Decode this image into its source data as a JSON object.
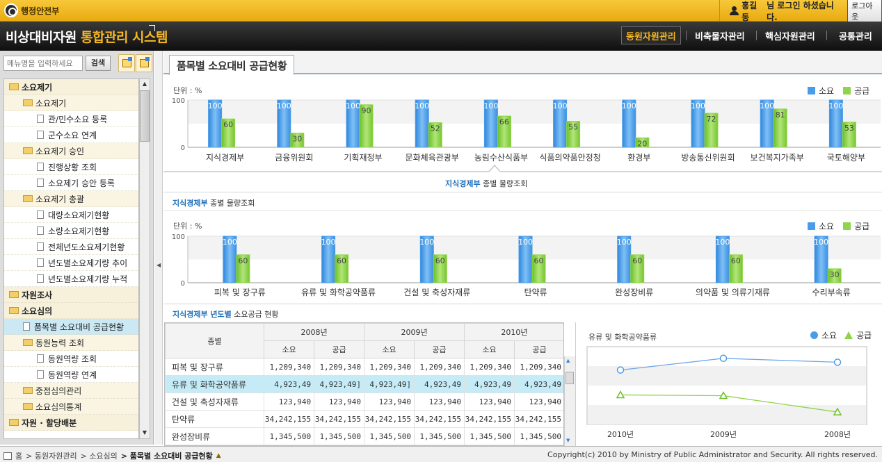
{
  "topbar": {
    "org": "행정안전부",
    "user_name": "홍길동",
    "user_suffix": "님 로그인 하셨습니다.",
    "logout": "로그아웃"
  },
  "header": {
    "title_plain": "비상대비자원",
    "title_highlight": "통합관리 시스템",
    "nav": [
      "동원자원관리",
      "비축물자관리",
      "핵심자원관리",
      "공통관리"
    ],
    "nav_active": 0
  },
  "sidebar": {
    "search_placeholder": "메뉴명을 입력하세요",
    "search_button": "검색",
    "tree": [
      {
        "label": "소요제기",
        "level": 0,
        "type": "folder"
      },
      {
        "label": "소요제기",
        "level": 1,
        "type": "folder"
      },
      {
        "label": "관/민수소요 등록",
        "level": 2,
        "type": "doc"
      },
      {
        "label": "군수소요 연계",
        "level": 2,
        "type": "doc"
      },
      {
        "label": "소요제기 승인",
        "level": 1,
        "type": "folder"
      },
      {
        "label": "진행상황 조회",
        "level": 2,
        "type": "doc"
      },
      {
        "label": "소요제기 승안 등록",
        "level": 2,
        "type": "doc"
      },
      {
        "label": "소요제기 총괄",
        "level": 1,
        "type": "folder"
      },
      {
        "label": "대량소요제기현황",
        "level": 2,
        "type": "doc"
      },
      {
        "label": "소량소요제기현황",
        "level": 2,
        "type": "doc"
      },
      {
        "label": "전체년도소요제기현황",
        "level": 2,
        "type": "doc"
      },
      {
        "label": "년도별소요제기량 추이",
        "level": 2,
        "type": "doc"
      },
      {
        "label": "년도별소요제기량 누적",
        "level": 2,
        "type": "doc"
      },
      {
        "label": "자원조사",
        "level": 0,
        "type": "folder"
      },
      {
        "label": "소요심의",
        "level": 0,
        "type": "folder"
      },
      {
        "label": "품목별 소요대비 공급현황",
        "level": 1,
        "type": "doc",
        "selected": true
      },
      {
        "label": "동원능력 조회",
        "level": 1,
        "type": "folder"
      },
      {
        "label": "동원역량 조회",
        "level": 2,
        "type": "doc"
      },
      {
        "label": "동원역량 연계",
        "level": 2,
        "type": "doc"
      },
      {
        "label": "중점심의관리",
        "level": 1,
        "type": "folder"
      },
      {
        "label": "소요심의통계",
        "level": 1,
        "type": "folder"
      },
      {
        "label": "자원 · 할당배분",
        "level": 0,
        "type": "folder"
      }
    ]
  },
  "main": {
    "tab": "품목별 소요대비 공급현황",
    "unit_label": "단위 : %",
    "legend": {
      "demand": "소요",
      "supply": "공급"
    },
    "selected_dept": "지식경제부",
    "detail_caption_suffix": "종별 물량조회",
    "section2_title_blue": "지식경제부",
    "section2_title_rest": "종별 물량조회",
    "section3_title_blue": "지식경제부 년도별",
    "section3_title_rest": "소요공급 현황",
    "linechart_title": "유류 및 화학공약품류",
    "colors": {
      "demand": "#4a9ce8",
      "supply": "#8fd44a",
      "accent": "#f7b823"
    }
  },
  "chart_data": [
    {
      "type": "bar",
      "categories": [
        "지식경제부",
        "금융위원회",
        "기획재정부",
        "문화체육관광부",
        "농림수산식품부",
        "식품의약품안정청",
        "환경부",
        "방송통신위원회",
        "보건복지가족부",
        "국토해양부"
      ],
      "series": [
        {
          "name": "소요",
          "values": [
            100,
            100,
            100,
            100,
            100,
            100,
            100,
            100,
            100,
            100
          ]
        },
        {
          "name": "공급",
          "values": [
            60,
            30,
            90,
            52,
            66,
            55,
            20,
            72,
            81,
            53
          ]
        }
      ],
      "ylim": [
        0,
        100
      ],
      "yticks": [
        0,
        100
      ],
      "legend": "top-right"
    },
    {
      "type": "bar",
      "categories": [
        "피복 및 장구류",
        "유류 및 화학공약품류",
        "건설 및 축성자재류",
        "탄약류",
        "완성장비류",
        "의약품 및 의류기재류",
        "수리부속류"
      ],
      "series": [
        {
          "name": "소요",
          "values": [
            100,
            100,
            100,
            100,
            100,
            100,
            100
          ]
        },
        {
          "name": "공급",
          "values": [
            60,
            60,
            60,
            60,
            60,
            60,
            30
          ]
        }
      ],
      "ylim": [
        0,
        100
      ],
      "yticks": [
        0,
        100
      ],
      "legend": "top-right"
    },
    {
      "type": "table",
      "header_group": "종별",
      "years": [
        "2008년",
        "2009년",
        "2010년"
      ],
      "subcols": [
        "소요",
        "공급"
      ],
      "rows": [
        {
          "name": "피복 및 장구류",
          "cells": [
            "1,209,340",
            "1,209,340",
            "1,209,340",
            "1,209,340",
            "1,209,340",
            "1,209,340"
          ]
        },
        {
          "name": "유류 및 화학공약품류",
          "cells": [
            "4,923,49",
            "4,923,49]",
            "4,923,49]",
            "4,923,49",
            "4,923,49",
            "4,923,49"
          ],
          "selected": true
        },
        {
          "name": "건설 및 축성자재류",
          "cells": [
            "123,940",
            "123,940",
            "123,940",
            "123,940",
            "123,940",
            "123,940"
          ]
        },
        {
          "name": "탄약류",
          "cells": [
            "34,242,155",
            "34,242,155",
            "34,242,155",
            "34,242,155",
            "34,242,155",
            "34,242,155"
          ]
        },
        {
          "name": "완성장비류",
          "cells": [
            "1,345,500",
            "1,345,500",
            "1,345,500",
            "1,345,500",
            "1,345,500",
            "1,345,500"
          ]
        }
      ]
    },
    {
      "type": "line",
      "x": [
        "2010년",
        "2009년",
        "2008년"
      ],
      "series": [
        {
          "name": "소요",
          "values": [
            0.7,
            0.85,
            0.8
          ]
        },
        {
          "name": "공급",
          "values": [
            0.38,
            0.37,
            0.16
          ]
        }
      ],
      "ylim": [
        0,
        1
      ],
      "legend": "top-right"
    }
  ],
  "footer": {
    "breadcrumb": [
      "홈",
      "동원자원관리",
      "소요심의"
    ],
    "breadcrumb_current": "품목별 소요대비 공급현황",
    "copyright": "Copyright(c) 2010 by Ministry of Public Administrator and Security. All rights reserved."
  }
}
